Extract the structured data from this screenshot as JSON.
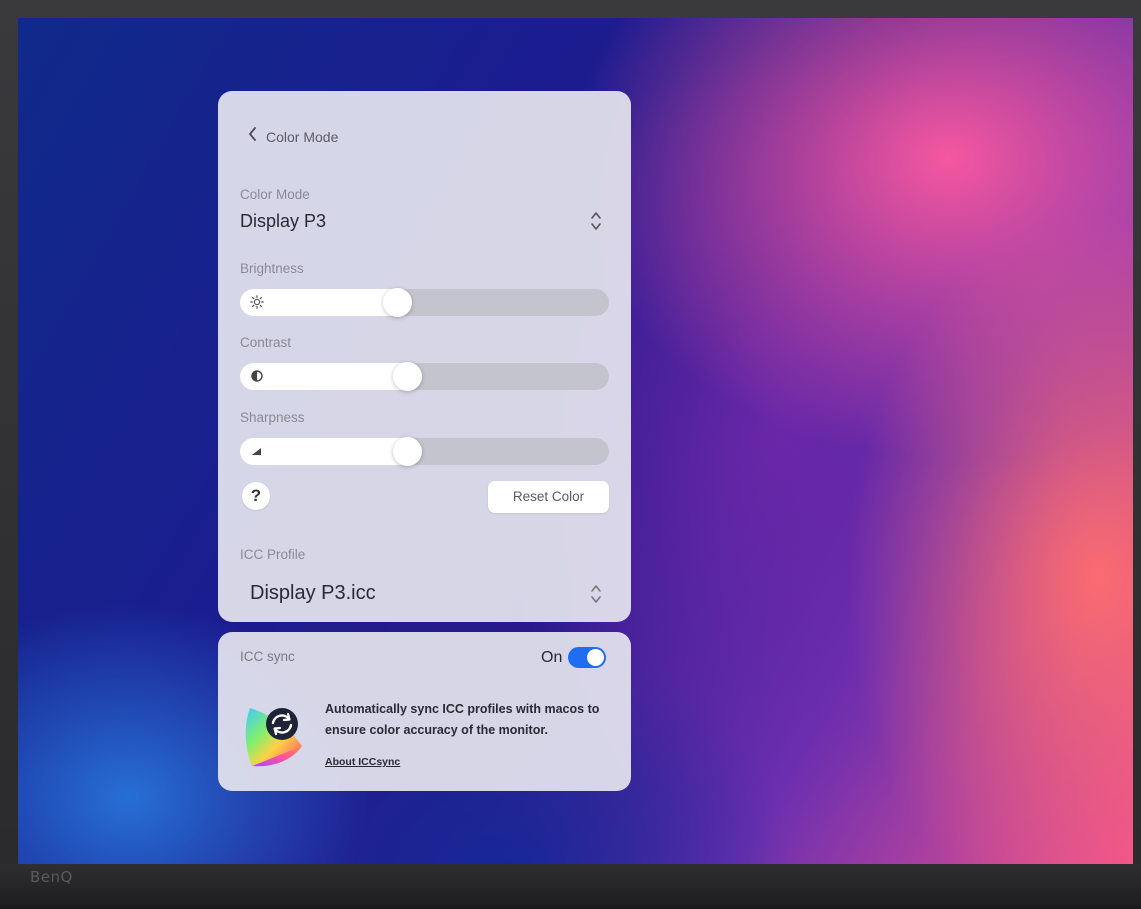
{
  "brand": "BenQ",
  "panel": {
    "header_title": "Color Mode",
    "color_mode": {
      "label": "Color Mode",
      "value": "Display P3"
    },
    "brightness": {
      "label": "Brightness",
      "level": 0.42
    },
    "contrast": {
      "label": "Contrast",
      "level": 0.45
    },
    "sharpness": {
      "label": "Sharpness",
      "level": 0.45
    },
    "help_label": "?",
    "reset_label": "Reset Color",
    "icc_profile": {
      "label": "ICC Profile",
      "value": "Display P3.icc"
    }
  },
  "icc_sync": {
    "label": "ICC sync",
    "state_text": "On",
    "enabled": true,
    "description": "Automatically sync ICC profiles with macos to ensure color accuracy of the monitor.",
    "about_link": "About ICCsync",
    "accent_color": "#1f6df2"
  },
  "icons": {
    "back": "chevron-left-icon",
    "stepper": "chevron-up-down-icon",
    "brightness": "sun-icon",
    "contrast": "contrast-icon",
    "sharpness": "sharpness-triangle-icon",
    "sync_logo": "icc-sync-logo-icon"
  }
}
